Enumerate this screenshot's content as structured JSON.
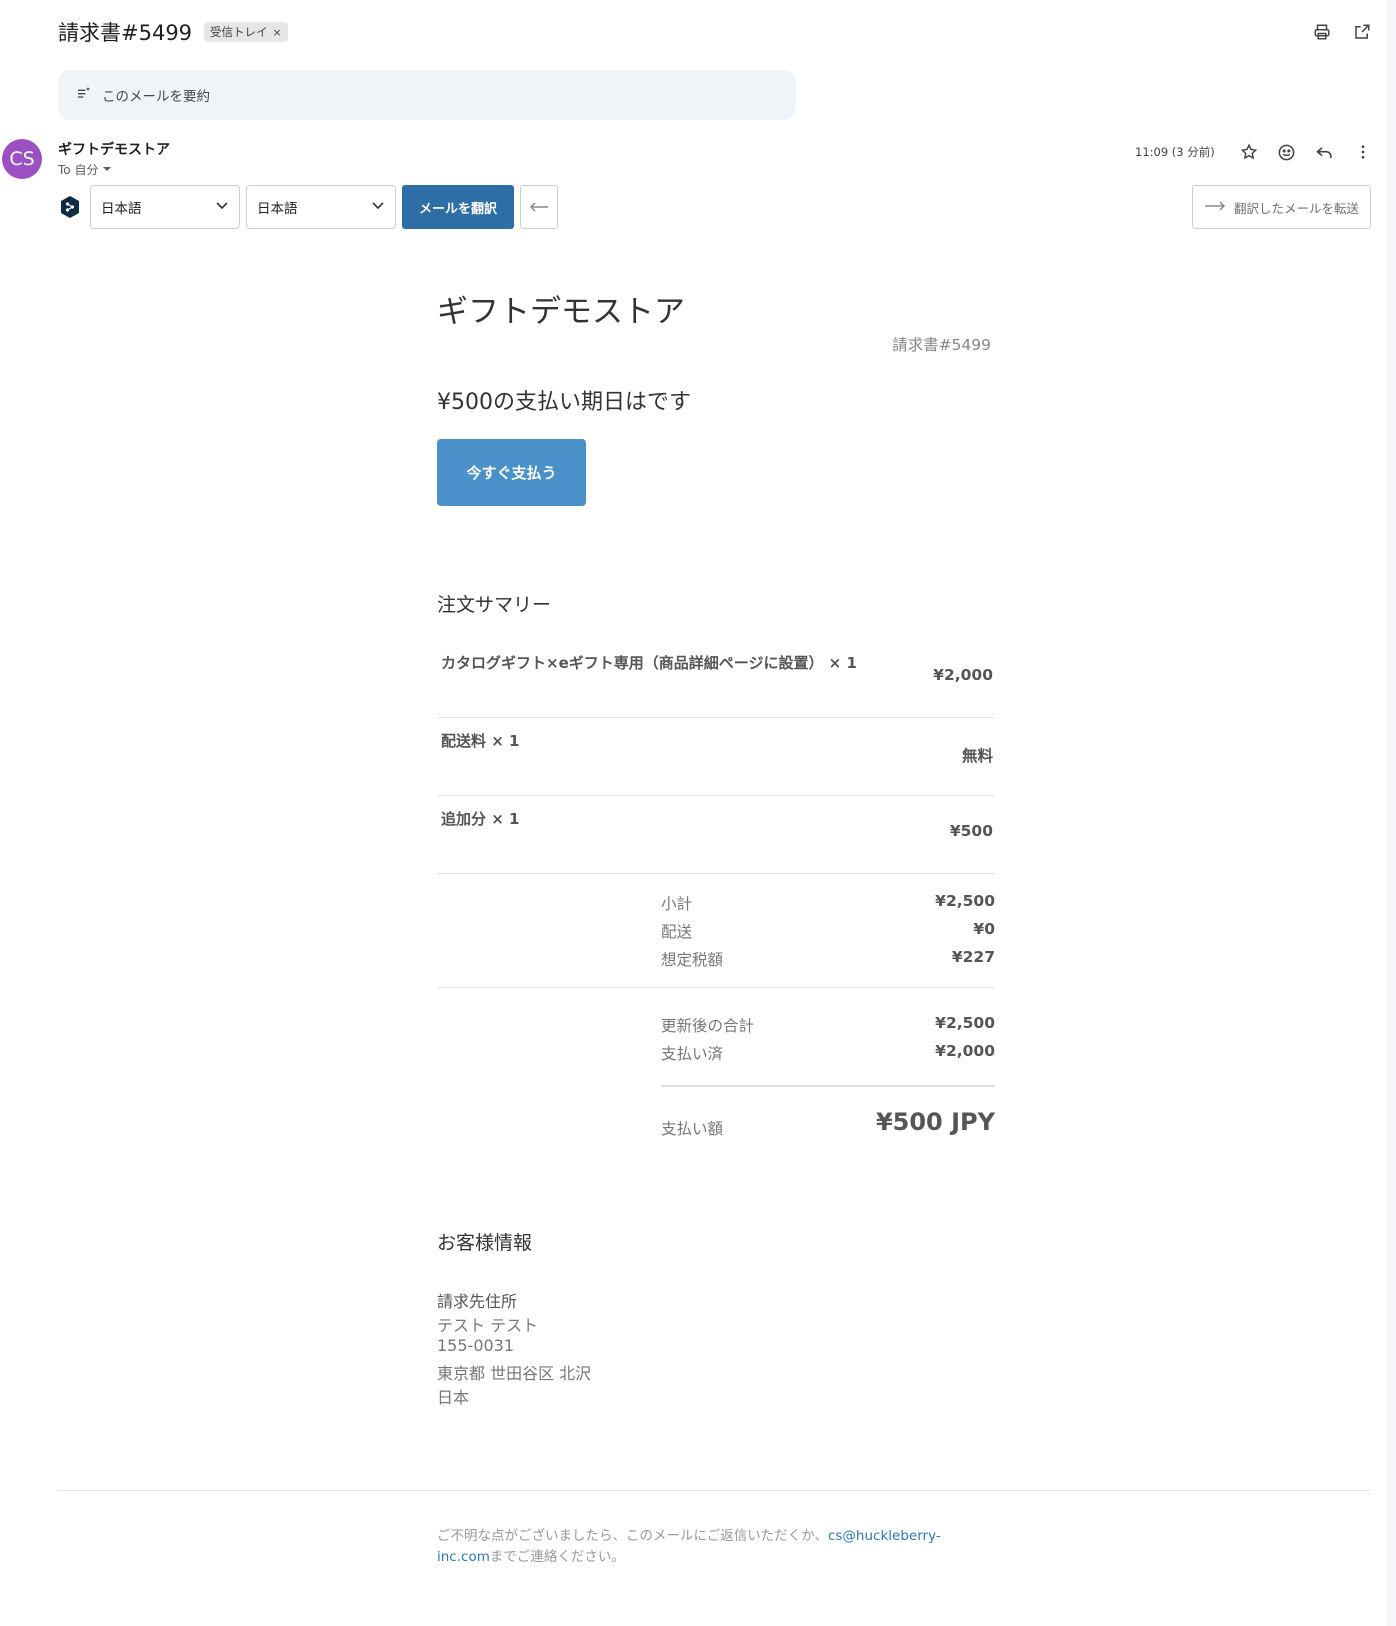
{
  "header": {
    "subject": "請求書#5499",
    "label": "受信トレイ",
    "label_remove": "×"
  },
  "summary": {
    "label": "このメールを要約"
  },
  "message": {
    "avatar_initials": "CS",
    "avatar_color": "#9b51c3",
    "sender": "ギフトデモストア",
    "to": "To 自分",
    "time": "11:09 (3 分前)"
  },
  "translate": {
    "source_lang": "日本語",
    "target_lang": "日本語",
    "translate_button": "メールを翻訳",
    "forward_button": "翻訳したメールを転送",
    "accent_color": "#2e6ea6"
  },
  "email": {
    "store_name": "ギフトデモストア",
    "invoice_number": "請求書#5499",
    "due_text": "¥500の支払い期日はです",
    "pay_button": "今すぐ支払う",
    "pay_button_color": "#4a90c9",
    "order_summary_title": "注文サマリー",
    "line_items": [
      {
        "name": "カタログギフト×eギフト専用（商品詳細ページに設置） × 1",
        "price": "¥2,000"
      },
      {
        "name": "配送料 × 1",
        "price": "無料"
      },
      {
        "name": "追加分 × 1",
        "price": "¥500"
      }
    ],
    "subtotals": [
      {
        "label": "小計",
        "value": "¥2,500"
      },
      {
        "label": "配送",
        "value": "¥0"
      },
      {
        "label": "想定税額",
        "value": "¥227"
      }
    ],
    "updated": [
      {
        "label": "更新後の合計",
        "value": "¥2,500"
      },
      {
        "label": "支払い済",
        "value": "¥2,000"
      }
    ],
    "amount_due": {
      "label": "支払い額",
      "value": "¥500 JPY"
    },
    "customer_info_title": "お客様情報",
    "billing_address_title": "請求先住所",
    "billing_address": [
      "テスト テスト",
      "155-0031",
      "東京都 世田谷区 北沢",
      "日本"
    ],
    "footer_text_before": "ご不明な点がございましたら、このメールにご返信いただくか、",
    "footer_email": "cs@huckleberry-inc.com",
    "footer_text_after": "までご連絡ください。"
  }
}
